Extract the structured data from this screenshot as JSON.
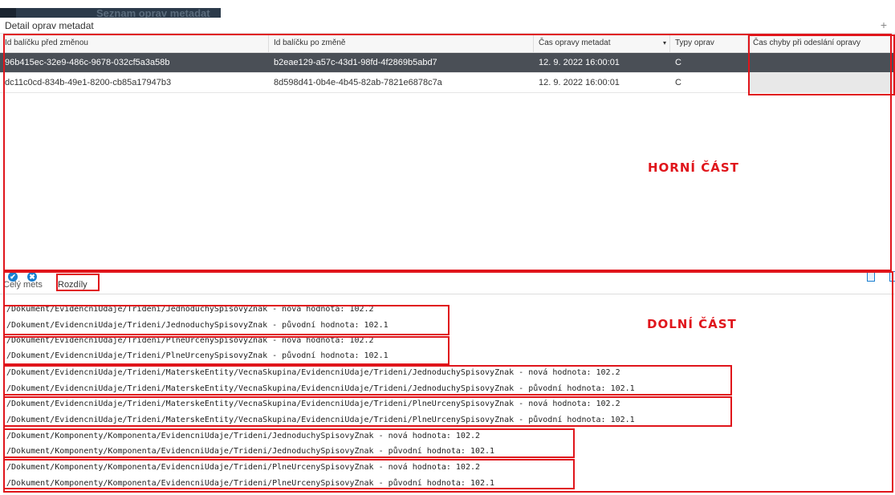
{
  "background": {
    "ghost_title": "Seznam oprav metadat"
  },
  "dialog": {
    "title": "Detail oprav metadat",
    "plus_icon": "+"
  },
  "grid": {
    "columns": [
      "Id balíčku před změnou",
      "Id balíčku po změně",
      "Čas opravy metadat",
      "Typy oprav",
      "Čas chyby při odeslání opravy"
    ],
    "sorted_column_icon": "▾",
    "rows": [
      {
        "before": "96b415ec-32e9-486c-9678-032cf5a3a58b",
        "after": "b2eae129-a57c-43d1-98fd-4f2869b5abd7",
        "time": "12. 9. 2022 16:00:01",
        "type": "C",
        "error_time": ""
      },
      {
        "before": "dc11c0cd-834b-49e1-8200-cb85a17947b3",
        "after": "8d598d41-0b4e-4b45-82ab-7821e6878c7a",
        "time": "12. 9. 2022 16:00:01",
        "type": "C",
        "error_time": ""
      }
    ],
    "footer": {
      "confirm_icon": "✔",
      "cancel_icon": "✖",
      "export_icon": "document-export-icon"
    }
  },
  "tabs": {
    "whole": "Celý mets",
    "diffs": "Rozdíly"
  },
  "annotations": {
    "upper": "HORNÍ ČÁST",
    "lower": "DOLNÍ ČÁST"
  },
  "diff_lines": [
    "/Dokument/EvidencniUdaje/Trideni/JednoduchySpisovyZnak - nová hodnota: 102.2",
    "/Dokument/EvidencniUdaje/Trideni/JednoduchySpisovyZnak - původní hodnota: 102.1",
    "/Dokument/EvidencniUdaje/Trideni/PlneUrcenySpisovyZnak - nová hodnota: 102.2",
    "/Dokument/EvidencniUdaje/Trideni/PlneUrcenySpisovyZnak - původní hodnota: 102.1",
    "/Dokument/EvidencniUdaje/Trideni/MaterskeEntity/VecnaSkupina/EvidencniUdaje/Trideni/JednoduchySpisovyZnak - nová hodnota: 102.2",
    "/Dokument/EvidencniUdaje/Trideni/MaterskeEntity/VecnaSkupina/EvidencniUdaje/Trideni/JednoduchySpisovyZnak - původní hodnota: 102.1",
    "/Dokument/EvidencniUdaje/Trideni/MaterskeEntity/VecnaSkupina/EvidencniUdaje/Trideni/PlneUrcenySpisovyZnak - nová hodnota: 102.2",
    "/Dokument/EvidencniUdaje/Trideni/MaterskeEntity/VecnaSkupina/EvidencniUdaje/Trideni/PlneUrcenySpisovyZnak - původní hodnota: 102.1",
    "/Dokument/Komponenty/Komponenta/EvidencniUdaje/Trideni/JednoduchySpisovyZnak - nová hodnota: 102.2",
    "/Dokument/Komponenty/Komponenta/EvidencniUdaje/Trideni/JednoduchySpisovyZnak - původní hodnota: 102.1",
    "/Dokument/Komponenty/Komponenta/EvidencniUdaje/Trideni/PlneUrcenySpisovyZnak - nová hodnota: 102.2",
    "/Dokument/Komponenty/Komponenta/EvidencniUdaje/Trideni/PlneUrcenySpisovyZnak - původní hodnota: 102.1"
  ],
  "colors": {
    "annotation_red": "#e0151b",
    "selected_row": "#4a4f56",
    "accent_blue": "#1a7fcf"
  }
}
